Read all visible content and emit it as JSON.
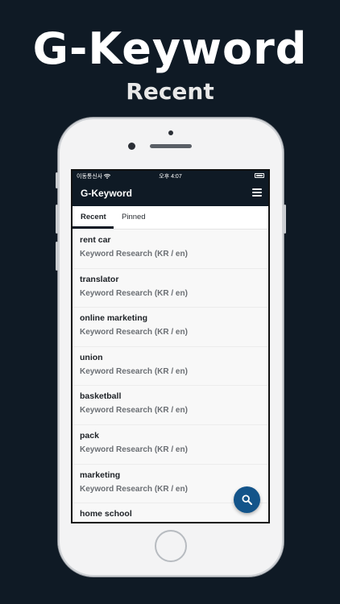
{
  "hero": {
    "title": "G-Keyword",
    "subtitle": "Recent"
  },
  "status_bar": {
    "carrier": "이동통신사",
    "time": "오후 4:07"
  },
  "app_bar": {
    "title": "G-Keyword",
    "menu_icon": "hamburger-menu-icon"
  },
  "tabs": [
    {
      "label": "Recent",
      "active": true
    },
    {
      "label": "Pinned",
      "active": false
    }
  ],
  "items": [
    {
      "keyword": "rent car",
      "source": "Keyword Research (KR / en)"
    },
    {
      "keyword": "translator",
      "source": "Keyword Research (KR / en)"
    },
    {
      "keyword": "online marketing",
      "source": "Keyword Research (KR / en)"
    },
    {
      "keyword": "union",
      "source": "Keyword Research (KR / en)"
    },
    {
      "keyword": "basketball",
      "source": "Keyword Research (KR / en)"
    },
    {
      "keyword": "pack",
      "source": "Keyword Research (KR / en)"
    },
    {
      "keyword": "marketing",
      "source": "Keyword Research (KR / en)"
    },
    {
      "keyword": "home school",
      "source": ""
    }
  ],
  "fab": {
    "icon": "search-icon",
    "color": "#13548a"
  },
  "colors": {
    "background": "#0f1a25",
    "accent": "#13548a"
  }
}
